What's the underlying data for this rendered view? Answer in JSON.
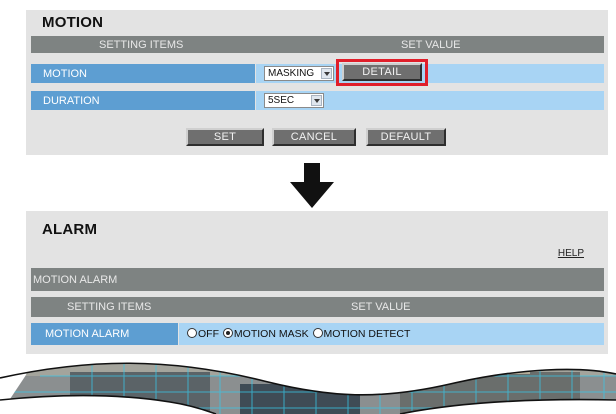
{
  "motion": {
    "title": "MOTION",
    "header": {
      "setting_items": "SETTING ITEMS",
      "set_value": "SET VALUE"
    },
    "rows": [
      {
        "label": "MOTION",
        "select_value": "MASKING",
        "detail_button": "DETAIL"
      },
      {
        "label": "DURATION",
        "select_value": "5SEC"
      }
    ],
    "buttons": {
      "set": "SET",
      "cancel": "CANCEL",
      "default": "DEFAULT"
    }
  },
  "alarm": {
    "title": "ALARM",
    "help": "HELP",
    "section": "MOTION ALARM",
    "header": {
      "setting_items": "SETTING ITEMS",
      "set_value": "SET VALUE"
    },
    "row": {
      "label": "MOTION ALARM",
      "options": [
        "OFF",
        "MOTION MASK",
        "MOTION DETECT"
      ],
      "selected": "MOTION MASK"
    }
  },
  "colors": {
    "panel_bg": "#e3e3e3",
    "header_gray": "#7e8382",
    "row_blue": "#5d9ed2",
    "value_blue": "#a8d4f4",
    "highlight_red": "#e01e2a"
  },
  "icons": {
    "transition": "down-arrow-icon",
    "select": "chevron-down-icon"
  }
}
